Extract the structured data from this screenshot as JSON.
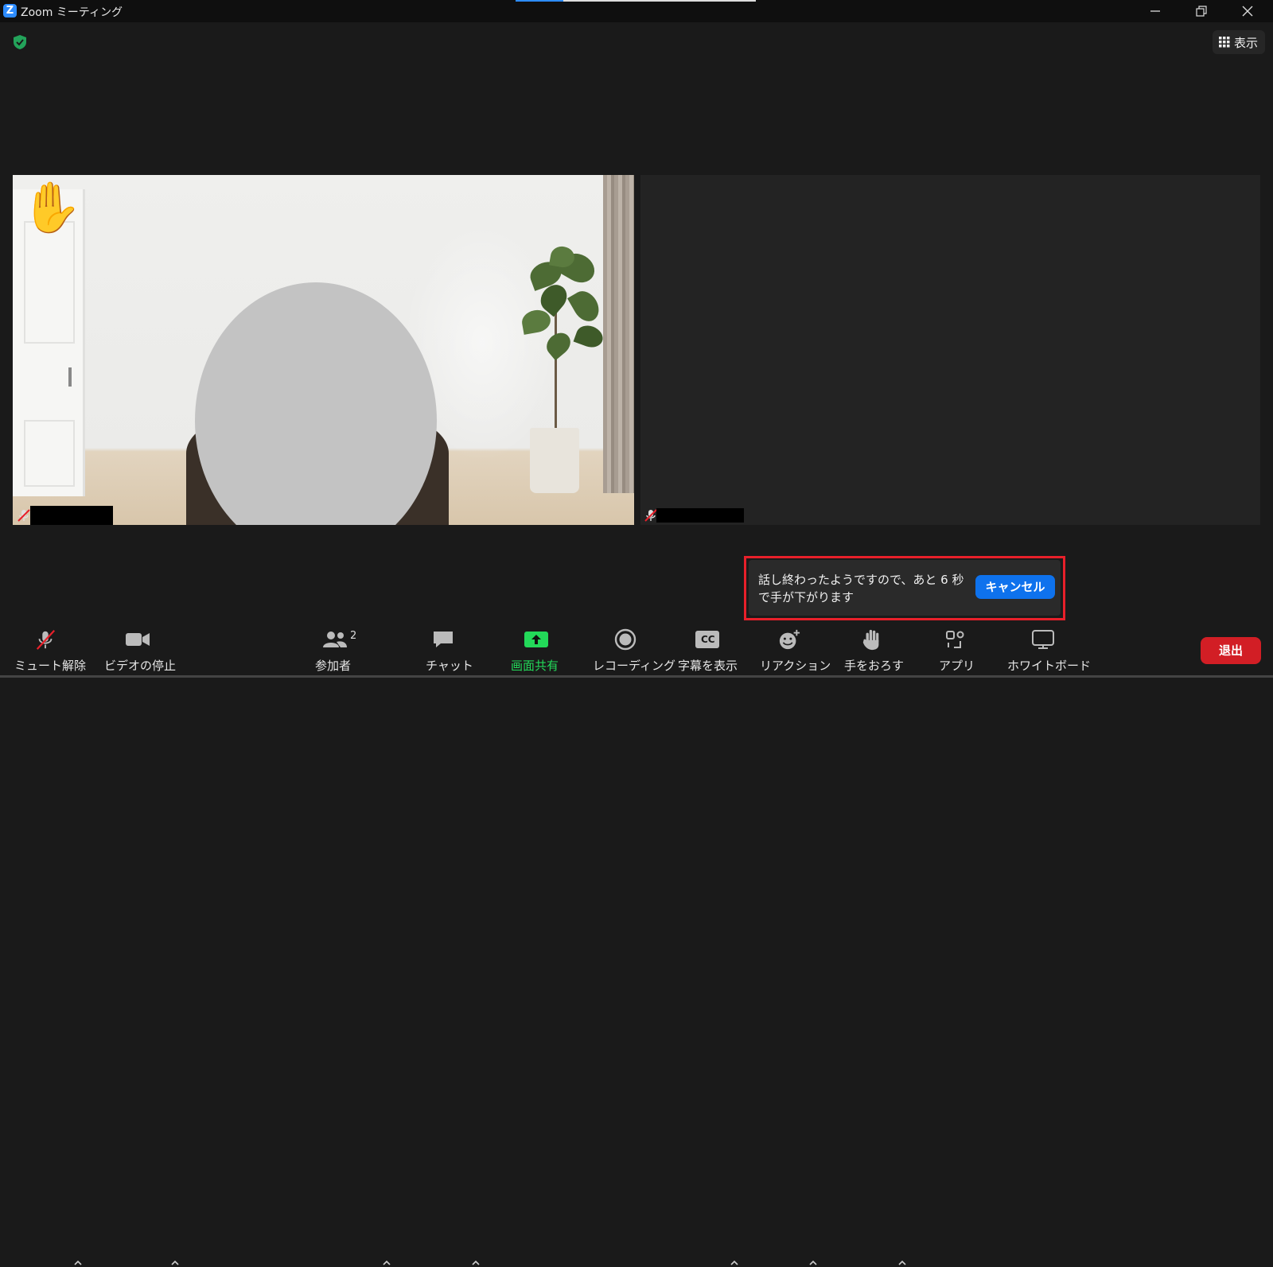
{
  "window": {
    "logo": "Z",
    "title": "Zoom ミーティング",
    "progress_fraction": 0.2
  },
  "top_right": {
    "view_label": "表示"
  },
  "video_tiles": {
    "left": {
      "reaction": "✋"
    },
    "right": {}
  },
  "notice": {
    "message": "話し終わったようですので、あと 6 秒で手が下がります",
    "cancel_label": "キャンセル"
  },
  "toolbar": {
    "unmute_label": "ミュート解除",
    "stop_video_label": "ビデオの停止",
    "participants_label": "参加者",
    "participants_count": "2",
    "chat_label": "チャット",
    "share_label": "画面共有",
    "record_label": "レコーディング",
    "captions_label": "字幕を表示",
    "cc_glyph": "CC",
    "reactions_label": "リアクション",
    "lower_hand_label": "手をおろす",
    "apps_label": "アプリ",
    "whiteboard_label": "ホワイトボード",
    "leave_label": "退出"
  },
  "colors": {
    "accent": "#0e72ed",
    "share_green": "#23d959",
    "leave_red": "#d21e25",
    "highlight_red": "#e8202a",
    "shield_green": "#23a35a"
  },
  "icons": [
    "zoom-logo-icon",
    "minimize-icon",
    "restore-icon",
    "close-icon",
    "shield-check-icon",
    "grid-view-icon",
    "mic-muted-icon",
    "video-camera-icon",
    "participants-icon",
    "chat-bubble-icon",
    "share-screen-icon",
    "record-icon",
    "captions-icon",
    "reaction-emoji-icon",
    "raise-hand-icon",
    "apps-icon",
    "whiteboard-icon",
    "caret-up-icon"
  ]
}
